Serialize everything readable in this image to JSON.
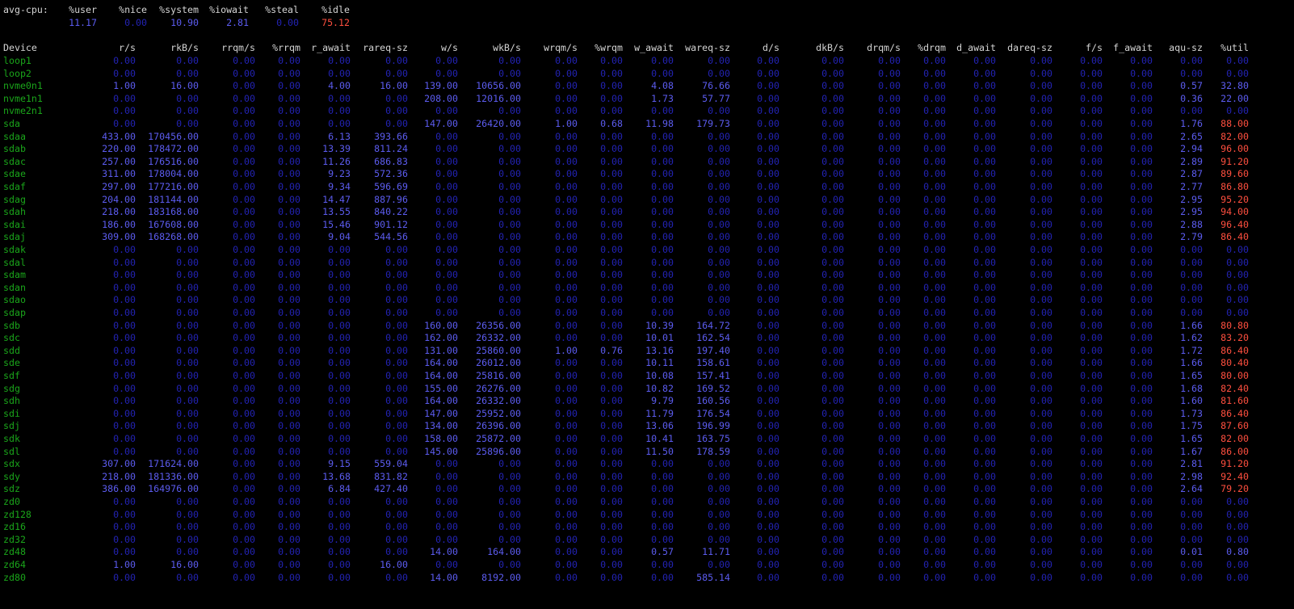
{
  "colors": {
    "background": "#000000",
    "header": "#d4d4d4",
    "device": "#1aa51a",
    "zero": "#2323b4",
    "value": "#5c5cf0",
    "high": "#ff4f3f"
  },
  "cpu": {
    "label": "avg-cpu:",
    "headers": [
      "%user",
      "%nice",
      "%system",
      "%iowait",
      "%steal",
      "%idle"
    ],
    "values": [
      "11.17",
      "0.00",
      "10.90",
      "2.81",
      "0.00",
      "75.12"
    ]
  },
  "columns": [
    "Device",
    "r/s",
    "rkB/s",
    "rrqm/s",
    "%rrqm",
    "r_await",
    "rareq-sz",
    "w/s",
    "wkB/s",
    "wrqm/s",
    "%wrqm",
    "w_await",
    "wareq-sz",
    "d/s",
    "dkB/s",
    "drqm/s",
    "%drqm",
    "d_await",
    "dareq-sz",
    "f/s",
    "f_await",
    "aqu-sz",
    "%util"
  ],
  "devices": [
    {
      "name": "loop1",
      "values": [
        "0.00",
        "0.00",
        "0.00",
        "0.00",
        "0.00",
        "0.00",
        "0.00",
        "0.00",
        "0.00",
        "0.00",
        "0.00",
        "0.00",
        "0.00",
        "0.00",
        "0.00",
        "0.00",
        "0.00",
        "0.00",
        "0.00",
        "0.00",
        "0.00",
        "0.00"
      ]
    },
    {
      "name": "loop2",
      "values": [
        "0.00",
        "0.00",
        "0.00",
        "0.00",
        "0.00",
        "0.00",
        "0.00",
        "0.00",
        "0.00",
        "0.00",
        "0.00",
        "0.00",
        "0.00",
        "0.00",
        "0.00",
        "0.00",
        "0.00",
        "0.00",
        "0.00",
        "0.00",
        "0.00",
        "0.00"
      ]
    },
    {
      "name": "nvme0n1",
      "values": [
        "1.00",
        "16.00",
        "0.00",
        "0.00",
        "4.00",
        "16.00",
        "139.00",
        "10656.00",
        "0.00",
        "0.00",
        "4.08",
        "76.66",
        "0.00",
        "0.00",
        "0.00",
        "0.00",
        "0.00",
        "0.00",
        "0.00",
        "0.00",
        "0.57",
        "32.80"
      ]
    },
    {
      "name": "nvme1n1",
      "values": [
        "0.00",
        "0.00",
        "0.00",
        "0.00",
        "0.00",
        "0.00",
        "208.00",
        "12016.00",
        "0.00",
        "0.00",
        "1.73",
        "57.77",
        "0.00",
        "0.00",
        "0.00",
        "0.00",
        "0.00",
        "0.00",
        "0.00",
        "0.00",
        "0.36",
        "22.00"
      ]
    },
    {
      "name": "nvme2n1",
      "values": [
        "0.00",
        "0.00",
        "0.00",
        "0.00",
        "0.00",
        "0.00",
        "0.00",
        "0.00",
        "0.00",
        "0.00",
        "0.00",
        "0.00",
        "0.00",
        "0.00",
        "0.00",
        "0.00",
        "0.00",
        "0.00",
        "0.00",
        "0.00",
        "0.00",
        "0.00"
      ]
    },
    {
      "name": "sda",
      "values": [
        "0.00",
        "0.00",
        "0.00",
        "0.00",
        "0.00",
        "0.00",
        "147.00",
        "26420.00",
        "1.00",
        "0.68",
        "11.98",
        "179.73",
        "0.00",
        "0.00",
        "0.00",
        "0.00",
        "0.00",
        "0.00",
        "0.00",
        "0.00",
        "1.76",
        "88.00"
      ]
    },
    {
      "name": "sdaa",
      "values": [
        "433.00",
        "170456.00",
        "0.00",
        "0.00",
        "6.13",
        "393.66",
        "0.00",
        "0.00",
        "0.00",
        "0.00",
        "0.00",
        "0.00",
        "0.00",
        "0.00",
        "0.00",
        "0.00",
        "0.00",
        "0.00",
        "0.00",
        "0.00",
        "2.65",
        "82.00"
      ]
    },
    {
      "name": "sdab",
      "values": [
        "220.00",
        "178472.00",
        "0.00",
        "0.00",
        "13.39",
        "811.24",
        "0.00",
        "0.00",
        "0.00",
        "0.00",
        "0.00",
        "0.00",
        "0.00",
        "0.00",
        "0.00",
        "0.00",
        "0.00",
        "0.00",
        "0.00",
        "0.00",
        "2.94",
        "96.00"
      ]
    },
    {
      "name": "sdac",
      "values": [
        "257.00",
        "176516.00",
        "0.00",
        "0.00",
        "11.26",
        "686.83",
        "0.00",
        "0.00",
        "0.00",
        "0.00",
        "0.00",
        "0.00",
        "0.00",
        "0.00",
        "0.00",
        "0.00",
        "0.00",
        "0.00",
        "0.00",
        "0.00",
        "2.89",
        "91.20"
      ]
    },
    {
      "name": "sdae",
      "values": [
        "311.00",
        "178004.00",
        "0.00",
        "0.00",
        "9.23",
        "572.36",
        "0.00",
        "0.00",
        "0.00",
        "0.00",
        "0.00",
        "0.00",
        "0.00",
        "0.00",
        "0.00",
        "0.00",
        "0.00",
        "0.00",
        "0.00",
        "0.00",
        "2.87",
        "89.60"
      ]
    },
    {
      "name": "sdaf",
      "values": [
        "297.00",
        "177216.00",
        "0.00",
        "0.00",
        "9.34",
        "596.69",
        "0.00",
        "0.00",
        "0.00",
        "0.00",
        "0.00",
        "0.00",
        "0.00",
        "0.00",
        "0.00",
        "0.00",
        "0.00",
        "0.00",
        "0.00",
        "0.00",
        "2.77",
        "86.80"
      ]
    },
    {
      "name": "sdag",
      "values": [
        "204.00",
        "181144.00",
        "0.00",
        "0.00",
        "14.47",
        "887.96",
        "0.00",
        "0.00",
        "0.00",
        "0.00",
        "0.00",
        "0.00",
        "0.00",
        "0.00",
        "0.00",
        "0.00",
        "0.00",
        "0.00",
        "0.00",
        "0.00",
        "2.95",
        "95.20"
      ]
    },
    {
      "name": "sdah",
      "values": [
        "218.00",
        "183168.00",
        "0.00",
        "0.00",
        "13.55",
        "840.22",
        "0.00",
        "0.00",
        "0.00",
        "0.00",
        "0.00",
        "0.00",
        "0.00",
        "0.00",
        "0.00",
        "0.00",
        "0.00",
        "0.00",
        "0.00",
        "0.00",
        "2.95",
        "94.00"
      ]
    },
    {
      "name": "sdai",
      "values": [
        "186.00",
        "167608.00",
        "0.00",
        "0.00",
        "15.46",
        "901.12",
        "0.00",
        "0.00",
        "0.00",
        "0.00",
        "0.00",
        "0.00",
        "0.00",
        "0.00",
        "0.00",
        "0.00",
        "0.00",
        "0.00",
        "0.00",
        "0.00",
        "2.88",
        "96.40"
      ]
    },
    {
      "name": "sdaj",
      "values": [
        "309.00",
        "168268.00",
        "0.00",
        "0.00",
        "9.04",
        "544.56",
        "0.00",
        "0.00",
        "0.00",
        "0.00",
        "0.00",
        "0.00",
        "0.00",
        "0.00",
        "0.00",
        "0.00",
        "0.00",
        "0.00",
        "0.00",
        "0.00",
        "2.79",
        "86.40"
      ]
    },
    {
      "name": "sdak",
      "values": [
        "0.00",
        "0.00",
        "0.00",
        "0.00",
        "0.00",
        "0.00",
        "0.00",
        "0.00",
        "0.00",
        "0.00",
        "0.00",
        "0.00",
        "0.00",
        "0.00",
        "0.00",
        "0.00",
        "0.00",
        "0.00",
        "0.00",
        "0.00",
        "0.00",
        "0.00"
      ]
    },
    {
      "name": "sdal",
      "values": [
        "0.00",
        "0.00",
        "0.00",
        "0.00",
        "0.00",
        "0.00",
        "0.00",
        "0.00",
        "0.00",
        "0.00",
        "0.00",
        "0.00",
        "0.00",
        "0.00",
        "0.00",
        "0.00",
        "0.00",
        "0.00",
        "0.00",
        "0.00",
        "0.00",
        "0.00"
      ]
    },
    {
      "name": "sdam",
      "values": [
        "0.00",
        "0.00",
        "0.00",
        "0.00",
        "0.00",
        "0.00",
        "0.00",
        "0.00",
        "0.00",
        "0.00",
        "0.00",
        "0.00",
        "0.00",
        "0.00",
        "0.00",
        "0.00",
        "0.00",
        "0.00",
        "0.00",
        "0.00",
        "0.00",
        "0.00"
      ]
    },
    {
      "name": "sdan",
      "values": [
        "0.00",
        "0.00",
        "0.00",
        "0.00",
        "0.00",
        "0.00",
        "0.00",
        "0.00",
        "0.00",
        "0.00",
        "0.00",
        "0.00",
        "0.00",
        "0.00",
        "0.00",
        "0.00",
        "0.00",
        "0.00",
        "0.00",
        "0.00",
        "0.00",
        "0.00"
      ]
    },
    {
      "name": "sdao",
      "values": [
        "0.00",
        "0.00",
        "0.00",
        "0.00",
        "0.00",
        "0.00",
        "0.00",
        "0.00",
        "0.00",
        "0.00",
        "0.00",
        "0.00",
        "0.00",
        "0.00",
        "0.00",
        "0.00",
        "0.00",
        "0.00",
        "0.00",
        "0.00",
        "0.00",
        "0.00"
      ]
    },
    {
      "name": "sdap",
      "values": [
        "0.00",
        "0.00",
        "0.00",
        "0.00",
        "0.00",
        "0.00",
        "0.00",
        "0.00",
        "0.00",
        "0.00",
        "0.00",
        "0.00",
        "0.00",
        "0.00",
        "0.00",
        "0.00",
        "0.00",
        "0.00",
        "0.00",
        "0.00",
        "0.00",
        "0.00"
      ]
    },
    {
      "name": "sdb",
      "values": [
        "0.00",
        "0.00",
        "0.00",
        "0.00",
        "0.00",
        "0.00",
        "160.00",
        "26356.00",
        "0.00",
        "0.00",
        "10.39",
        "164.72",
        "0.00",
        "0.00",
        "0.00",
        "0.00",
        "0.00",
        "0.00",
        "0.00",
        "0.00",
        "1.66",
        "80.80"
      ]
    },
    {
      "name": "sdc",
      "values": [
        "0.00",
        "0.00",
        "0.00",
        "0.00",
        "0.00",
        "0.00",
        "162.00",
        "26332.00",
        "0.00",
        "0.00",
        "10.01",
        "162.54",
        "0.00",
        "0.00",
        "0.00",
        "0.00",
        "0.00",
        "0.00",
        "0.00",
        "0.00",
        "1.62",
        "83.20"
      ]
    },
    {
      "name": "sdd",
      "values": [
        "0.00",
        "0.00",
        "0.00",
        "0.00",
        "0.00",
        "0.00",
        "131.00",
        "25860.00",
        "1.00",
        "0.76",
        "13.16",
        "197.40",
        "0.00",
        "0.00",
        "0.00",
        "0.00",
        "0.00",
        "0.00",
        "0.00",
        "0.00",
        "1.72",
        "86.40"
      ]
    },
    {
      "name": "sde",
      "values": [
        "0.00",
        "0.00",
        "0.00",
        "0.00",
        "0.00",
        "0.00",
        "164.00",
        "26012.00",
        "0.00",
        "0.00",
        "10.11",
        "158.61",
        "0.00",
        "0.00",
        "0.00",
        "0.00",
        "0.00",
        "0.00",
        "0.00",
        "0.00",
        "1.66",
        "80.40"
      ]
    },
    {
      "name": "sdf",
      "values": [
        "0.00",
        "0.00",
        "0.00",
        "0.00",
        "0.00",
        "0.00",
        "164.00",
        "25816.00",
        "0.00",
        "0.00",
        "10.08",
        "157.41",
        "0.00",
        "0.00",
        "0.00",
        "0.00",
        "0.00",
        "0.00",
        "0.00",
        "0.00",
        "1.65",
        "80.00"
      ]
    },
    {
      "name": "sdg",
      "values": [
        "0.00",
        "0.00",
        "0.00",
        "0.00",
        "0.00",
        "0.00",
        "155.00",
        "26276.00",
        "0.00",
        "0.00",
        "10.82",
        "169.52",
        "0.00",
        "0.00",
        "0.00",
        "0.00",
        "0.00",
        "0.00",
        "0.00",
        "0.00",
        "1.68",
        "82.40"
      ]
    },
    {
      "name": "sdh",
      "values": [
        "0.00",
        "0.00",
        "0.00",
        "0.00",
        "0.00",
        "0.00",
        "164.00",
        "26332.00",
        "0.00",
        "0.00",
        "9.79",
        "160.56",
        "0.00",
        "0.00",
        "0.00",
        "0.00",
        "0.00",
        "0.00",
        "0.00",
        "0.00",
        "1.60",
        "81.60"
      ]
    },
    {
      "name": "sdi",
      "values": [
        "0.00",
        "0.00",
        "0.00",
        "0.00",
        "0.00",
        "0.00",
        "147.00",
        "25952.00",
        "0.00",
        "0.00",
        "11.79",
        "176.54",
        "0.00",
        "0.00",
        "0.00",
        "0.00",
        "0.00",
        "0.00",
        "0.00",
        "0.00",
        "1.73",
        "86.40"
      ]
    },
    {
      "name": "sdj",
      "values": [
        "0.00",
        "0.00",
        "0.00",
        "0.00",
        "0.00",
        "0.00",
        "134.00",
        "26396.00",
        "0.00",
        "0.00",
        "13.06",
        "196.99",
        "0.00",
        "0.00",
        "0.00",
        "0.00",
        "0.00",
        "0.00",
        "0.00",
        "0.00",
        "1.75",
        "87.60"
      ]
    },
    {
      "name": "sdk",
      "values": [
        "0.00",
        "0.00",
        "0.00",
        "0.00",
        "0.00",
        "0.00",
        "158.00",
        "25872.00",
        "0.00",
        "0.00",
        "10.41",
        "163.75",
        "0.00",
        "0.00",
        "0.00",
        "0.00",
        "0.00",
        "0.00",
        "0.00",
        "0.00",
        "1.65",
        "82.00"
      ]
    },
    {
      "name": "sdl",
      "values": [
        "0.00",
        "0.00",
        "0.00",
        "0.00",
        "0.00",
        "0.00",
        "145.00",
        "25896.00",
        "0.00",
        "0.00",
        "11.50",
        "178.59",
        "0.00",
        "0.00",
        "0.00",
        "0.00",
        "0.00",
        "0.00",
        "0.00",
        "0.00",
        "1.67",
        "86.00"
      ]
    },
    {
      "name": "sdx",
      "values": [
        "307.00",
        "171624.00",
        "0.00",
        "0.00",
        "9.15",
        "559.04",
        "0.00",
        "0.00",
        "0.00",
        "0.00",
        "0.00",
        "0.00",
        "0.00",
        "0.00",
        "0.00",
        "0.00",
        "0.00",
        "0.00",
        "0.00",
        "0.00",
        "2.81",
        "91.20"
      ]
    },
    {
      "name": "sdy",
      "values": [
        "218.00",
        "181336.00",
        "0.00",
        "0.00",
        "13.68",
        "831.82",
        "0.00",
        "0.00",
        "0.00",
        "0.00",
        "0.00",
        "0.00",
        "0.00",
        "0.00",
        "0.00",
        "0.00",
        "0.00",
        "0.00",
        "0.00",
        "0.00",
        "2.98",
        "92.40"
      ]
    },
    {
      "name": "sdz",
      "values": [
        "386.00",
        "164976.00",
        "0.00",
        "0.00",
        "6.84",
        "427.40",
        "0.00",
        "0.00",
        "0.00",
        "0.00",
        "0.00",
        "0.00",
        "0.00",
        "0.00",
        "0.00",
        "0.00",
        "0.00",
        "0.00",
        "0.00",
        "0.00",
        "2.64",
        "79.20"
      ]
    },
    {
      "name": "zd0",
      "values": [
        "0.00",
        "0.00",
        "0.00",
        "0.00",
        "0.00",
        "0.00",
        "0.00",
        "0.00",
        "0.00",
        "0.00",
        "0.00",
        "0.00",
        "0.00",
        "0.00",
        "0.00",
        "0.00",
        "0.00",
        "0.00",
        "0.00",
        "0.00",
        "0.00",
        "0.00"
      ]
    },
    {
      "name": "zd128",
      "values": [
        "0.00",
        "0.00",
        "0.00",
        "0.00",
        "0.00",
        "0.00",
        "0.00",
        "0.00",
        "0.00",
        "0.00",
        "0.00",
        "0.00",
        "0.00",
        "0.00",
        "0.00",
        "0.00",
        "0.00",
        "0.00",
        "0.00",
        "0.00",
        "0.00",
        "0.00"
      ]
    },
    {
      "name": "zd16",
      "values": [
        "0.00",
        "0.00",
        "0.00",
        "0.00",
        "0.00",
        "0.00",
        "0.00",
        "0.00",
        "0.00",
        "0.00",
        "0.00",
        "0.00",
        "0.00",
        "0.00",
        "0.00",
        "0.00",
        "0.00",
        "0.00",
        "0.00",
        "0.00",
        "0.00",
        "0.00"
      ]
    },
    {
      "name": "zd32",
      "values": [
        "0.00",
        "0.00",
        "0.00",
        "0.00",
        "0.00",
        "0.00",
        "0.00",
        "0.00",
        "0.00",
        "0.00",
        "0.00",
        "0.00",
        "0.00",
        "0.00",
        "0.00",
        "0.00",
        "0.00",
        "0.00",
        "0.00",
        "0.00",
        "0.00",
        "0.00"
      ]
    },
    {
      "name": "zd48",
      "values": [
        "0.00",
        "0.00",
        "0.00",
        "0.00",
        "0.00",
        "0.00",
        "14.00",
        "164.00",
        "0.00",
        "0.00",
        "0.57",
        "11.71",
        "0.00",
        "0.00",
        "0.00",
        "0.00",
        "0.00",
        "0.00",
        "0.00",
        "0.00",
        "0.01",
        "0.80"
      ]
    },
    {
      "name": "zd64",
      "values": [
        "1.00",
        "16.00",
        "0.00",
        "0.00",
        "0.00",
        "16.00",
        "0.00",
        "0.00",
        "0.00",
        "0.00",
        "0.00",
        "0.00",
        "0.00",
        "0.00",
        "0.00",
        "0.00",
        "0.00",
        "0.00",
        "0.00",
        "0.00",
        "0.00",
        "0.00"
      ]
    },
    {
      "name": "zd80",
      "values": [
        "0.00",
        "0.00",
        "0.00",
        "0.00",
        "0.00",
        "0.00",
        "14.00",
        "8192.00",
        "0.00",
        "0.00",
        "0.00",
        "585.14",
        "0.00",
        "0.00",
        "0.00",
        "0.00",
        "0.00",
        "0.00",
        "0.00",
        "0.00",
        "0.00",
        "0.00"
      ]
    }
  ]
}
